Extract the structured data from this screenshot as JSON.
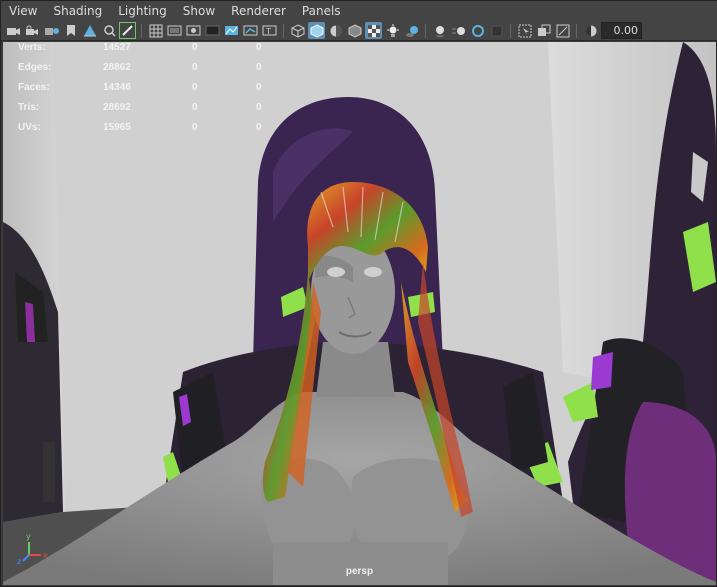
{
  "menu": [
    "View",
    "Shading",
    "Lighting",
    "Show",
    "Renderer",
    "Panels"
  ],
  "toolbar": {
    "icons": [
      "camera-icon",
      "camera-lock-icon",
      "camera-attributes-icon",
      "bookmark-icon",
      "image-plane-icon",
      "focus-icon",
      "grease-pencil-icon",
      "sep",
      "grid-icon",
      "film-gate-icon",
      "resolution-gate-icon",
      "gate-mask-icon",
      "field-chart-icon",
      "safe-action-icon",
      "safe-title-icon",
      "sep",
      "wireframe-icon",
      "smooth-shade-icon",
      "default-material-icon",
      "xray-icon",
      "textured-icon",
      "use-lights-icon",
      "shadows-icon",
      "sep",
      "screen-space-ao-icon",
      "motion-blur-icon",
      "multisample-aa-icon",
      "depth-of-field-icon",
      "sep",
      "isolate-select-icon",
      "xray-active-icon",
      "xray-joints-icon",
      "sep",
      "exposure-icon"
    ],
    "exposure_value": "0.00"
  },
  "hud": {
    "rows": [
      {
        "label": "Verts:",
        "v1": "14527",
        "v2": "0",
        "v3": "0"
      },
      {
        "label": "Edges:",
        "v1": "28862",
        "v2": "0",
        "v3": "0"
      },
      {
        "label": "Faces:",
        "v1": "14346",
        "v2": "0",
        "v3": "0"
      },
      {
        "label": "Tris:",
        "v1": "28692",
        "v2": "0",
        "v3": "0"
      },
      {
        "label": "UVs:",
        "v1": "15965",
        "v2": "0",
        "v3": "0"
      }
    ]
  },
  "axis": {
    "y": "y",
    "x": "x",
    "z": "z"
  },
  "camera_label": "persp",
  "colors": {
    "background": "#d4d4d4",
    "floor": "#5c5c5c",
    "skin": "#8f8f8f",
    "hair_dark": "#3b2450",
    "accent_green": "#8fe04a",
    "accent_purple": "#9b3ad0"
  }
}
